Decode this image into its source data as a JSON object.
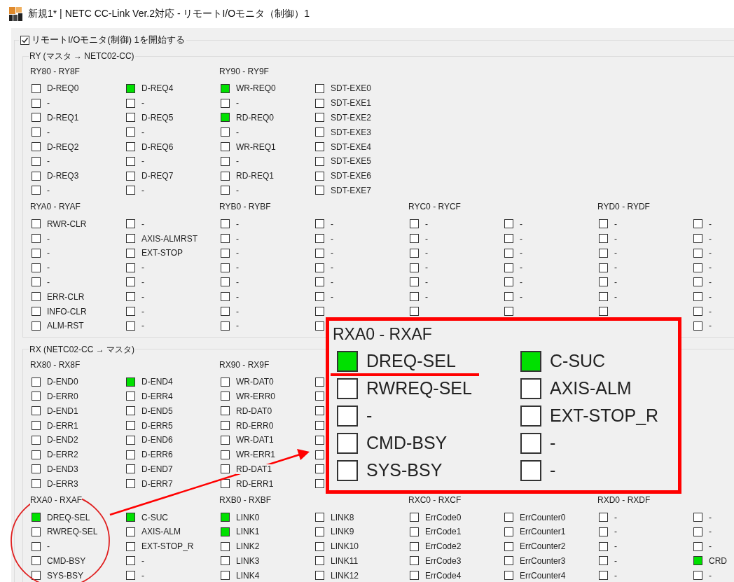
{
  "window": {
    "title": "新規1* | NETC CC-Link Ver.2対応 - リモートI/Oモニタ（制御）1"
  },
  "monitor": {
    "label": "リモートI/Oモニタ(制御) 1を開始する",
    "checked": true,
    "sections": [
      {
        "title": "RY (マスタ → NETC02-CC)",
        "group_rows": [
          [
            {
              "title": "RY80 - RY8F",
              "columns": [
                [
                  {
                    "label": "D-REQ0",
                    "checked": false
                  },
                  {
                    "label": "-",
                    "checked": false
                  },
                  {
                    "label": "D-REQ1",
                    "checked": false
                  },
                  {
                    "label": "-",
                    "checked": false
                  },
                  {
                    "label": "D-REQ2",
                    "checked": false
                  },
                  {
                    "label": "-",
                    "checked": false
                  },
                  {
                    "label": "D-REQ3",
                    "checked": false
                  },
                  {
                    "label": "-",
                    "checked": false
                  }
                ],
                [
                  {
                    "label": "D-REQ4",
                    "checked": true
                  },
                  {
                    "label": "-",
                    "checked": false
                  },
                  {
                    "label": "D-REQ5",
                    "checked": false
                  },
                  {
                    "label": "-",
                    "checked": false
                  },
                  {
                    "label": "D-REQ6",
                    "checked": false
                  },
                  {
                    "label": "-",
                    "checked": false
                  },
                  {
                    "label": "D-REQ7",
                    "checked": false
                  },
                  {
                    "label": "-",
                    "checked": false
                  }
                ]
              ]
            },
            {
              "title": "RY90 - RY9F",
              "columns": [
                [
                  {
                    "label": "WR-REQ0",
                    "checked": true
                  },
                  {
                    "label": "-",
                    "checked": false
                  },
                  {
                    "label": "RD-REQ0",
                    "checked": true
                  },
                  {
                    "label": "-",
                    "checked": false
                  },
                  {
                    "label": "WR-REQ1",
                    "checked": false
                  },
                  {
                    "label": "-",
                    "checked": false
                  },
                  {
                    "label": "RD-REQ1",
                    "checked": false
                  },
                  {
                    "label": "-",
                    "checked": false
                  }
                ],
                [
                  {
                    "label": "SDT-EXE0",
                    "checked": false
                  },
                  {
                    "label": "SDT-EXE1",
                    "checked": false
                  },
                  {
                    "label": "SDT-EXE2",
                    "checked": false
                  },
                  {
                    "label": "SDT-EXE3",
                    "checked": false
                  },
                  {
                    "label": "SDT-EXE4",
                    "checked": false
                  },
                  {
                    "label": "SDT-EXE5",
                    "checked": false
                  },
                  {
                    "label": "SDT-EXE6",
                    "checked": false
                  },
                  {
                    "label": "SDT-EXE7",
                    "checked": false
                  }
                ]
              ]
            }
          ],
          [
            {
              "title": "RYA0 - RYAF",
              "columns": [
                [
                  {
                    "label": "RWR-CLR",
                    "checked": false
                  },
                  {
                    "label": "-",
                    "checked": false
                  },
                  {
                    "label": "-",
                    "checked": false
                  },
                  {
                    "label": "-",
                    "checked": false
                  },
                  {
                    "label": "-",
                    "checked": false
                  },
                  {
                    "label": "ERR-CLR",
                    "checked": false
                  },
                  {
                    "label": "INFO-CLR",
                    "checked": false
                  },
                  {
                    "label": "ALM-RST",
                    "checked": false
                  }
                ],
                [
                  {
                    "label": "-",
                    "checked": false
                  },
                  {
                    "label": "AXIS-ALMRST",
                    "checked": false
                  },
                  {
                    "label": "EXT-STOP",
                    "checked": false
                  },
                  {
                    "label": "-",
                    "checked": false
                  },
                  {
                    "label": "-",
                    "checked": false
                  },
                  {
                    "label": "-",
                    "checked": false
                  },
                  {
                    "label": "-",
                    "checked": false
                  },
                  {
                    "label": "-",
                    "checked": false
                  }
                ]
              ]
            },
            {
              "title": "RYB0 - RYBF",
              "columns": [
                [
                  {
                    "label": "-",
                    "checked": false
                  },
                  {
                    "label": "-",
                    "checked": false
                  },
                  {
                    "label": "-",
                    "checked": false
                  },
                  {
                    "label": "-",
                    "checked": false
                  },
                  {
                    "label": "-",
                    "checked": false
                  },
                  {
                    "label": "-",
                    "checked": false
                  },
                  {
                    "label": "-",
                    "checked": false
                  },
                  {
                    "label": "-",
                    "checked": false
                  }
                ],
                [
                  {
                    "label": "-",
                    "checked": false
                  },
                  {
                    "label": "-",
                    "checked": false
                  },
                  {
                    "label": "-",
                    "checked": false
                  },
                  {
                    "label": "-",
                    "checked": false
                  },
                  {
                    "label": "-",
                    "checked": false
                  },
                  {
                    "label": "-",
                    "checked": false
                  },
                  {
                    "checked": false
                  },
                  {
                    "checked": false
                  }
                ]
              ]
            },
            {
              "title": "RYC0 - RYCF",
              "columns": [
                [
                  {
                    "label": "-",
                    "checked": false
                  },
                  {
                    "label": "-",
                    "checked": false
                  },
                  {
                    "label": "-",
                    "checked": false
                  },
                  {
                    "label": "-",
                    "checked": false
                  },
                  {
                    "label": "-",
                    "checked": false
                  },
                  {
                    "label": "-",
                    "checked": false
                  },
                  {
                    "checked": false
                  }
                ],
                [
                  {
                    "label": "-",
                    "checked": false
                  },
                  {
                    "label": "-",
                    "checked": false
                  },
                  {
                    "label": "-",
                    "checked": false
                  },
                  {
                    "label": "-",
                    "checked": false
                  },
                  {
                    "label": "-",
                    "checked": false
                  },
                  {
                    "label": "-",
                    "checked": false
                  },
                  {
                    "checked": false
                  }
                ]
              ]
            },
            {
              "title": "RYD0 - RYDF",
              "columns": [
                [
                  {
                    "label": "-",
                    "checked": false
                  },
                  {
                    "label": "-",
                    "checked": false
                  },
                  {
                    "label": "-",
                    "checked": false
                  },
                  {
                    "label": "-",
                    "checked": false
                  },
                  {
                    "label": "-",
                    "checked": false
                  },
                  {
                    "label": "-",
                    "checked": false
                  },
                  {
                    "checked": false
                  }
                ],
                [
                  {
                    "label": "-",
                    "checked": false
                  },
                  {
                    "label": "-",
                    "checked": false
                  },
                  {
                    "label": "-",
                    "checked": false
                  },
                  {
                    "label": "-",
                    "checked": false
                  },
                  {
                    "label": "-",
                    "checked": false
                  },
                  {
                    "label": "-",
                    "checked": false
                  },
                  {
                    "label": "-",
                    "checked": false
                  },
                  {
                    "label": "-",
                    "checked": false
                  }
                ]
              ]
            }
          ]
        ]
      },
      {
        "title": "RX (NETC02-CC → マスタ)",
        "group_rows": [
          [
            {
              "title": "RX80 - RX8F",
              "columns": [
                [
                  {
                    "label": "D-END0",
                    "checked": false
                  },
                  {
                    "label": "D-ERR0",
                    "checked": false
                  },
                  {
                    "label": "D-END1",
                    "checked": false
                  },
                  {
                    "label": "D-ERR1",
                    "checked": false
                  },
                  {
                    "label": "D-END2",
                    "checked": false
                  },
                  {
                    "label": "D-ERR2",
                    "checked": false
                  },
                  {
                    "label": "D-END3",
                    "checked": false
                  },
                  {
                    "label": "D-ERR3",
                    "checked": false
                  }
                ],
                [
                  {
                    "label": "D-END4",
                    "checked": true
                  },
                  {
                    "label": "D-ERR4",
                    "checked": false
                  },
                  {
                    "label": "D-END5",
                    "checked": false
                  },
                  {
                    "label": "D-ERR5",
                    "checked": false
                  },
                  {
                    "label": "D-END6",
                    "checked": false
                  },
                  {
                    "label": "D-ERR6",
                    "checked": false
                  },
                  {
                    "label": "D-END7",
                    "checked": false
                  },
                  {
                    "label": "D-ERR7",
                    "checked": false
                  }
                ]
              ]
            },
            {
              "title": "RX90 - RX9F",
              "columns": [
                [
                  {
                    "label": "WR-DAT0",
                    "checked": false
                  },
                  {
                    "label": "WR-ERR0",
                    "checked": false
                  },
                  {
                    "label": "RD-DAT0",
                    "checked": false
                  },
                  {
                    "label": "RD-ERR0",
                    "checked": false
                  },
                  {
                    "label": "WR-DAT1",
                    "checked": false
                  },
                  {
                    "label": "WR-ERR1",
                    "checked": false
                  },
                  {
                    "label": "RD-DAT1",
                    "checked": false
                  },
                  {
                    "label": "RD-ERR1",
                    "checked": false
                  }
                ],
                [
                  {
                    "checked": false
                  },
                  {
                    "checked": false
                  },
                  {
                    "checked": false
                  },
                  {
                    "checked": false
                  },
                  {
                    "checked": false
                  },
                  {
                    "checked": false
                  },
                  {
                    "checked": false
                  },
                  {
                    "checked": false
                  }
                ]
              ]
            }
          ],
          [
            {
              "title": "RXA0 - RXAF",
              "columns": [
                [
                  {
                    "label": "DREQ-SEL",
                    "checked": true
                  },
                  {
                    "label": "RWREQ-SEL",
                    "checked": false
                  },
                  {
                    "label": "-",
                    "checked": false
                  },
                  {
                    "label": "CMD-BSY",
                    "checked": false
                  },
                  {
                    "label": "SYS-BSY",
                    "checked": false
                  }
                ],
                [
                  {
                    "label": "C-SUC",
                    "checked": true
                  },
                  {
                    "label": "AXIS-ALM",
                    "checked": false
                  },
                  {
                    "label": "EXT-STOP_R",
                    "checked": false
                  },
                  {
                    "label": "-",
                    "checked": false
                  },
                  {
                    "label": "-",
                    "checked": false
                  }
                ]
              ]
            },
            {
              "title": "RXB0 - RXBF",
              "columns": [
                [
                  {
                    "label": "LINK0",
                    "checked": true
                  },
                  {
                    "label": "LINK1",
                    "checked": true
                  },
                  {
                    "label": "LINK2",
                    "checked": false
                  },
                  {
                    "label": "LINK3",
                    "checked": false
                  },
                  {
                    "label": "LINK4",
                    "checked": false
                  }
                ],
                [
                  {
                    "label": "LINK8",
                    "checked": false
                  },
                  {
                    "label": "LINK9",
                    "checked": false
                  },
                  {
                    "label": "LINK10",
                    "checked": false
                  },
                  {
                    "label": "LINK11",
                    "checked": false
                  },
                  {
                    "label": "LINK12",
                    "checked": false
                  }
                ]
              ]
            },
            {
              "title": "RXC0 - RXCF",
              "columns": [
                [
                  {
                    "label": "ErrCode0",
                    "checked": false
                  },
                  {
                    "label": "ErrCode1",
                    "checked": false
                  },
                  {
                    "label": "ErrCode2",
                    "checked": false
                  },
                  {
                    "label": "ErrCode3",
                    "checked": false
                  },
                  {
                    "label": "ErrCode4",
                    "checked": false
                  }
                ],
                [
                  {
                    "label": "ErrCounter0",
                    "checked": false
                  },
                  {
                    "label": "ErrCounter1",
                    "checked": false
                  },
                  {
                    "label": "ErrCounter2",
                    "checked": false
                  },
                  {
                    "label": "ErrCounter3",
                    "checked": false
                  },
                  {
                    "label": "ErrCounter4",
                    "checked": false
                  }
                ]
              ]
            },
            {
              "title": "RXD0 - RXDF",
              "columns": [
                [
                  {
                    "label": "-",
                    "checked": false
                  },
                  {
                    "label": "-",
                    "checked": false
                  },
                  {
                    "label": "-",
                    "checked": false
                  },
                  {
                    "label": "-",
                    "checked": false
                  },
                  {
                    "label": "-",
                    "checked": false
                  }
                ],
                [
                  {
                    "label": "-",
                    "checked": false
                  },
                  {
                    "label": "-",
                    "checked": false
                  },
                  {
                    "label": "-",
                    "checked": false
                  },
                  {
                    "label": "CRD",
                    "checked": true
                  },
                  {
                    "label": "-",
                    "checked": false
                  }
                ]
              ]
            }
          ]
        ]
      }
    ]
  },
  "callout": {
    "title": "RXA0 - RXAF",
    "columns": [
      [
        {
          "label": "DREQ-SEL",
          "checked": true
        },
        {
          "label": "RWREQ-SEL",
          "checked": false
        },
        {
          "label": "-",
          "checked": false
        },
        {
          "label": "CMD-BSY",
          "checked": false
        },
        {
          "label": "SYS-BSY",
          "checked": false
        }
      ],
      [
        {
          "label": "C-SUC",
          "checked": true
        },
        {
          "label": "AXIS-ALM",
          "checked": false
        },
        {
          "label": "EXT-STOP_R",
          "checked": false
        },
        {
          "label": "-",
          "checked": false
        },
        {
          "label": "-",
          "checked": false
        }
      ]
    ]
  }
}
